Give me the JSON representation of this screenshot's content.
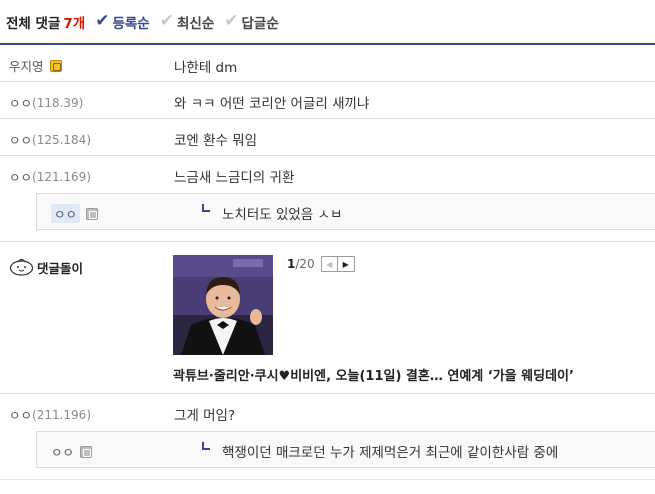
{
  "header": {
    "total_label": "전체 댓글",
    "count": "7개",
    "sort": [
      {
        "label": "등록순",
        "active": true
      },
      {
        "label": "최신순",
        "active": false
      },
      {
        "label": "답글순",
        "active": false
      }
    ]
  },
  "comments": [
    {
      "nick": "우지영",
      "ip": "",
      "text": "나한테 dm"
    },
    {
      "nick": "ㅇㅇ",
      "ip": "(118.39)",
      "text": "와 ㅋㅋ 어떤 코리안 어글리 새끼냐"
    },
    {
      "nick": "ㅇㅇ",
      "ip": "(125.184)",
      "text": "코엔 환수 뭐임"
    },
    {
      "nick": "ㅇㅇ",
      "ip": "(121.169)",
      "text": "느금새 느금디의 귀환"
    },
    {
      "nick": "ㅇㅇ",
      "ip": "(211.196)",
      "text": "그게 머임?"
    }
  ],
  "replies": [
    {
      "nick": "ㅇㅇ",
      "text": "노치터도 있었음 ㅅㅂ"
    },
    {
      "nick": "ㅇㅇ",
      "text": "핵쟁이던 매크로던 누가 제제먹은거 최근에 같이한사람 중에"
    }
  ],
  "bot": {
    "name": "댓글돌이",
    "pager_current": "1",
    "pager_total": "/20",
    "headline": "곽튜브·줄리안·쿠시♥비비엔, 오늘(11일) 결혼… 연예계 ‘가을 웨딩데이’"
  },
  "colors": {
    "accent": "#3b4890",
    "count": "#d31900"
  },
  "icons": [
    "check-icon",
    "fixed-nick-icon",
    "guest-nick-icon",
    "reply-arrow-icon",
    "bot-face-icon",
    "prev-arrow-icon",
    "next-arrow-icon"
  ]
}
